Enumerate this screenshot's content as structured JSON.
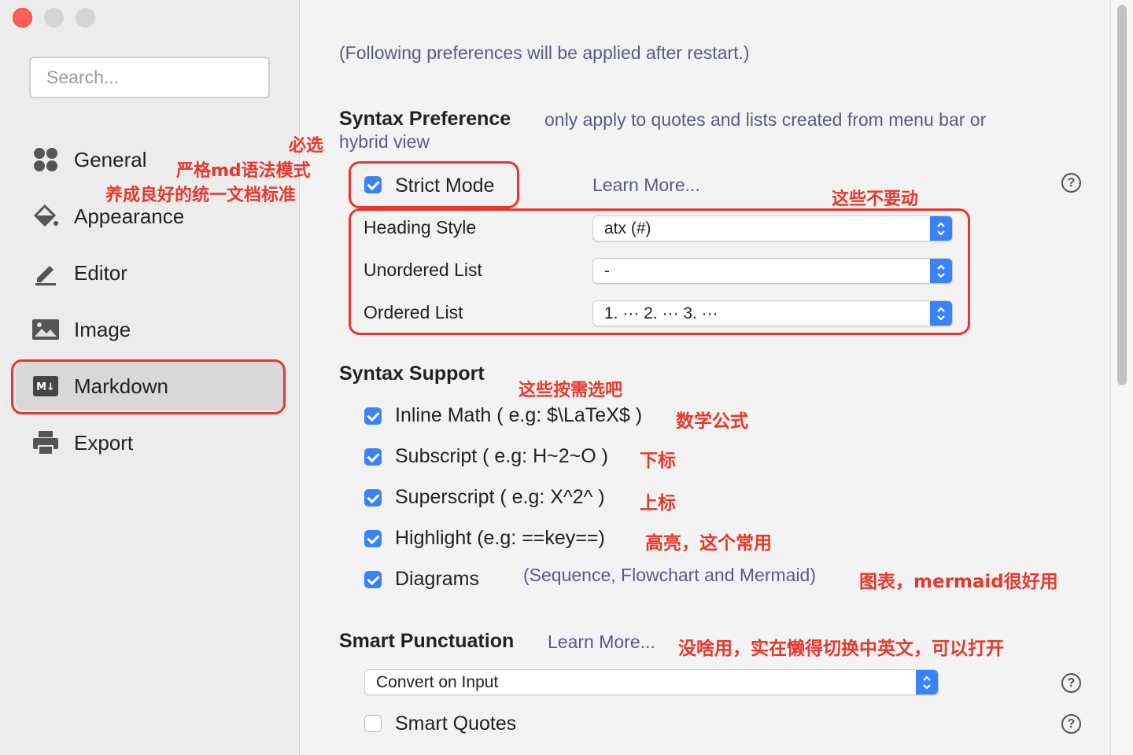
{
  "window": {
    "traffic_lights": [
      "close",
      "minimize",
      "maximize"
    ]
  },
  "sidebar": {
    "search_placeholder": "Search...",
    "items": [
      {
        "label": "General",
        "icon": "grid-icon"
      },
      {
        "label": "Appearance",
        "icon": "paint-bucket-icon"
      },
      {
        "label": "Editor",
        "icon": "pencil-icon"
      },
      {
        "label": "Image",
        "icon": "image-icon"
      },
      {
        "label": "Markdown",
        "icon": "markdown-icon",
        "active": true
      },
      {
        "label": "Export",
        "icon": "printer-icon"
      }
    ]
  },
  "main": {
    "restart_note": "(Following preferences will be applied after restart.)",
    "syntax_preference": {
      "title": "Syntax Preference",
      "note_line1": "only apply to quotes and lists created from menu bar or",
      "note_line2": "hybrid view",
      "strict_mode": {
        "label": "Strict Mode",
        "checked": true
      },
      "learn_more": "Learn More...",
      "heading_style": {
        "label": "Heading Style",
        "value": "atx (#)"
      },
      "unordered_list": {
        "label": "Unordered List",
        "value": "-"
      },
      "ordered_list": {
        "label": "Ordered List",
        "value": "1. ··· 2. ··· 3. ···"
      }
    },
    "syntax_support": {
      "title": "Syntax Support",
      "items": [
        {
          "label": "Inline Math ( e.g: $\\LaTeX$ )",
          "checked": true
        },
        {
          "label": "Subscript ( e.g: H~2~O )",
          "checked": true
        },
        {
          "label": "Superscript ( e.g: X^2^ )",
          "checked": true
        },
        {
          "label": "Highlight (e.g: ==key==)",
          "checked": true
        },
        {
          "label": "Diagrams",
          "checked": true
        }
      ],
      "diagrams_note": "(Sequence, Flowchart and Mermaid)"
    },
    "smart_punctuation": {
      "title": "Smart Punctuation",
      "learn_more": "Learn More...",
      "select_value": "Convert on Input",
      "smart_quotes": {
        "label": "Smart Quotes",
        "checked": false
      }
    }
  },
  "annotations": {
    "must_select": "必选",
    "strict_md": "严格md语法模式",
    "good_habit": "养成良好的统一文档标准",
    "dont_touch": "这些不要动",
    "choose_as_needed": "这些按需选吧",
    "math": "数学公式",
    "subscript": "下标",
    "superscript": "上标",
    "highlight": "高亮，这个常用",
    "diagrams": "图表，mermaid很好用",
    "smart_punct": "没啥用，实在懒得切换中英文，可以打开"
  },
  "colors": {
    "accent": "#3a82f7",
    "annotation_red": "#e8372c",
    "close_button": "#fe5f57"
  }
}
